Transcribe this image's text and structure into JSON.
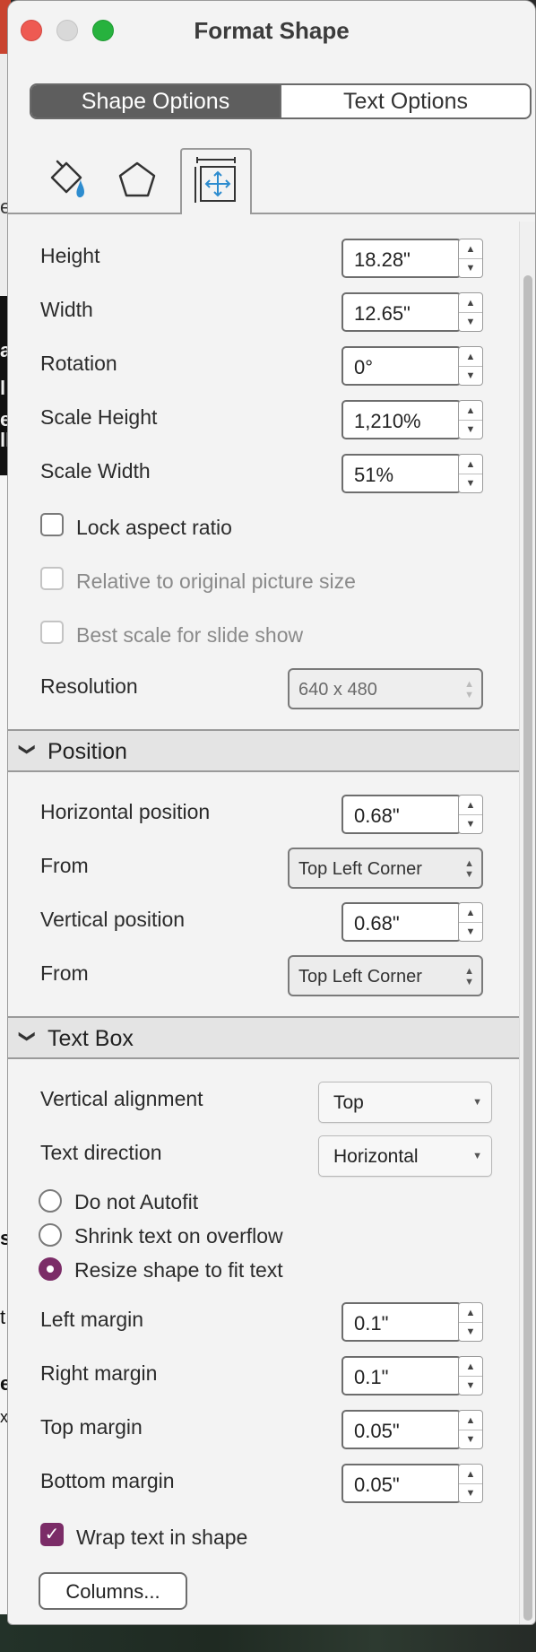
{
  "window": {
    "title": "Format Shape"
  },
  "segments": {
    "shape_options": "Shape Options",
    "text_options": "Text Options"
  },
  "tabs": [
    {
      "icon": "fill-bucket-icon"
    },
    {
      "icon": "pentagon-icon"
    },
    {
      "icon": "size-position-icon"
    }
  ],
  "size": {
    "height_label": "Height",
    "height_value": "18.28\"",
    "width_label": "Width",
    "width_value": "12.65\"",
    "rotation_label": "Rotation",
    "rotation_value": "0°",
    "scale_height_label": "Scale Height",
    "scale_height_value": "1,210%",
    "scale_width_label": "Scale Width",
    "scale_width_value": "51%",
    "lock_aspect_label": "Lock aspect ratio",
    "relative_label": "Relative to original picture size",
    "best_scale_label": "Best scale for slide show",
    "resolution_label": "Resolution",
    "resolution_value": "640 x 480"
  },
  "position": {
    "header": "Position",
    "horizontal_label": "Horizontal position",
    "horizontal_value": "0.68\"",
    "from1_label": "From",
    "from1_value": "Top Left Corner",
    "vertical_label": "Vertical position",
    "vertical_value": "0.68\"",
    "from2_label": "From",
    "from2_value": "Top Left Corner"
  },
  "textbox": {
    "header": "Text Box",
    "valign_label": "Vertical alignment",
    "valign_value": "Top",
    "direction_label": "Text direction",
    "direction_value": "Horizontal",
    "radio_do_not_autofit": "Do not Autofit",
    "radio_shrink": "Shrink text on overflow",
    "radio_resize": "Resize shape to fit text",
    "left_margin_label": "Left margin",
    "left_margin_value": "0.1\"",
    "right_margin_label": "Right margin",
    "right_margin_value": "0.1\"",
    "top_margin_label": "Top margin",
    "top_margin_value": "0.05\"",
    "bottom_margin_label": "Bottom margin",
    "bottom_margin_value": "0.05\"",
    "wrap_label": "Wrap text in shape",
    "columns_button": "Columns..."
  },
  "background_fragments": [
    "e",
    "a",
    "l",
    "e",
    "ll",
    "s",
    "t",
    "e",
    "xt"
  ],
  "colors": {
    "accent": "#7b2c67",
    "active_segment": "#5e5e5e",
    "tab_icon_blue": "#2d8ccf"
  }
}
